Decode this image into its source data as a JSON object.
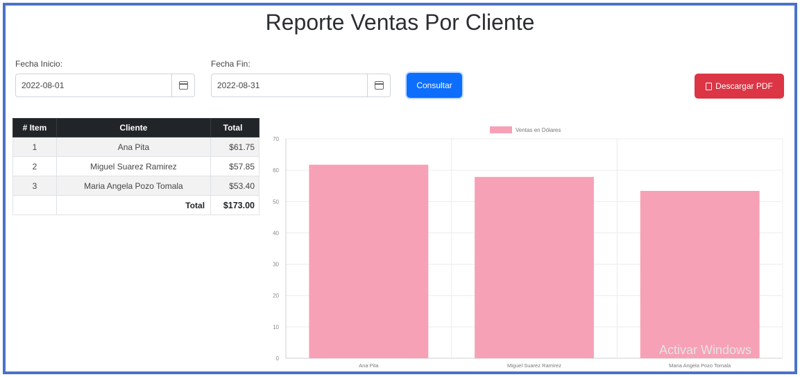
{
  "header": {
    "title": "Reporte Ventas Por Cliente"
  },
  "filters": {
    "start_label": "Fecha Inicio:",
    "start_value": "2022-08-01",
    "end_label": "Fecha Fin:",
    "end_value": "2022-08-31",
    "consult_label": "Consultar",
    "download_label": "Descargar PDF"
  },
  "table": {
    "headers": [
      "# Item",
      "Cliente",
      "Total"
    ],
    "rows": [
      {
        "item": "1",
        "cliente": "Ana Pita",
        "total": "$61.75"
      },
      {
        "item": "2",
        "cliente": "Miguel Suarez Ramirez",
        "total": "$57.85"
      },
      {
        "item": "3",
        "cliente": "Maria Angela Pozo Tomala",
        "total": "$53.40"
      }
    ],
    "footer": {
      "label": "Total",
      "value": "$173.00"
    }
  },
  "colors": {
    "bar": "#f7a1b6",
    "primary": "#0d6efd",
    "danger": "#dc3545"
  },
  "chart_data": {
    "type": "bar",
    "categories": [
      "Ana Pita",
      "Miguel Suarez Ramirez",
      "Maria Angela Pozo Tomala"
    ],
    "series": [
      {
        "name": "Ventas en Dólares",
        "values": [
          61.75,
          57.85,
          53.4
        ]
      }
    ],
    "ylim": [
      0,
      70
    ],
    "yticks": [
      0,
      10,
      20,
      30,
      40,
      50,
      60,
      70
    ],
    "legend_position": "top-center",
    "grid": true
  },
  "watermark": "Activar Windows"
}
